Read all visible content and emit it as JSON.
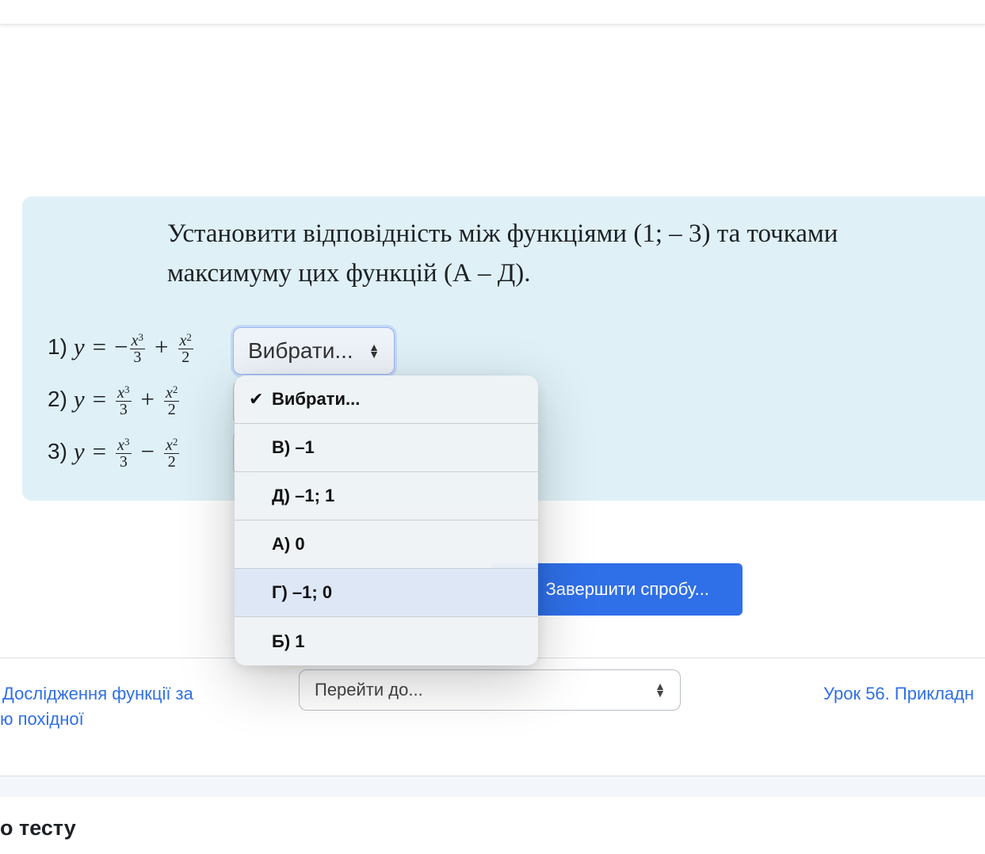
{
  "question": {
    "text": "Установити відповідність між функціями (1; – 3) та точками максимуму цих функцій (А – Д).",
    "rows": [
      {
        "num": "1)",
        "select_value": "Вибрати..."
      },
      {
        "num": "2)"
      },
      {
        "num": "3)"
      }
    ]
  },
  "dropdown": {
    "options": [
      {
        "label": "Вибрати...",
        "checked": true
      },
      {
        "label": "В) –1"
      },
      {
        "label": "Д) –1; 1"
      },
      {
        "label": "А) 0"
      },
      {
        "label": "Г) –1; 0"
      },
      {
        "label": "Б) 1"
      }
    ],
    "check_icon": "check-icon"
  },
  "actions": {
    "submit_label": "Завершити спробу..."
  },
  "navigation": {
    "prev_link": "Дослідження функції за ю похідної",
    "prev_line1": "Дослідження функції за",
    "prev_line2": "ю похідної",
    "jump_placeholder": "Перейти до...",
    "next_link": "Урок 56. Прикладн"
  },
  "footer": {
    "title": "о тесту"
  },
  "colors": {
    "accent": "#2f6fe8",
    "question_bg": "#dff1f7"
  }
}
